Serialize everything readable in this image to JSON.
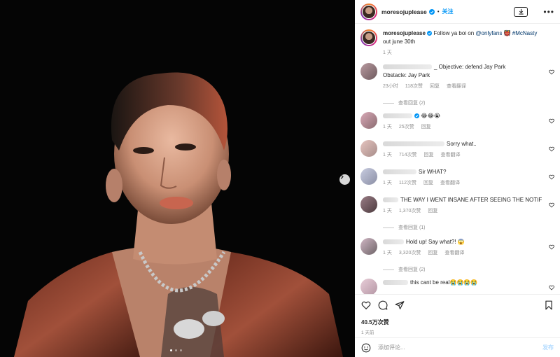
{
  "colors": {
    "accent": "#0095f6",
    "link": "#00376b",
    "muted": "#8e8e8e"
  },
  "post": {
    "username": "moresojuplease",
    "follow_label": "关注",
    "separator": "•",
    "more_label": "•••",
    "caption_prefix": "Follow ya boi on ",
    "caption_mention": "@onlyfans",
    "caption_emoji": "👹",
    "caption_hashtag": "#McNasty",
    "caption_line2": "out june 30th",
    "caption_time": "1 天",
    "carousel_total": 3,
    "carousel_active": 1
  },
  "comments": [
    {
      "text": "_ Objective: defend Jay Park",
      "line2": "Obstacle: Jay Park",
      "time": "23小时",
      "likes": "118次赞",
      "reply": "回复",
      "translate": "查看翻译",
      "replies": "查看回复 (2)"
    },
    {
      "text": "😂😂😭",
      "time": "1 天",
      "likes": "25次赞",
      "reply": "回复"
    },
    {
      "text": "Sorry what..",
      "time": "1 天",
      "likes": "714次赞",
      "reply": "回复",
      "translate": "查看翻译"
    },
    {
      "text": "Sir WHAT?",
      "time": "1 天",
      "likes": "112次赞",
      "reply": "回复",
      "translate": "查看翻译"
    },
    {
      "text": "THE WAY I WENT INSANE AFTER SEEING THE NOTIF",
      "time": "1 天",
      "likes": "1,370次赞",
      "reply": "回复",
      "replies": "查看回复 (1)"
    },
    {
      "text": "Hold up! Say what?! 😱",
      "time": "1 天",
      "likes": "3,320次赞",
      "reply": "回复",
      "translate": "查看翻译",
      "replies": "查看回复 (2)"
    },
    {
      "text": "this cant be real😭😭😭😭"
    }
  ],
  "footer": {
    "likes": "40.5万次赞",
    "time": "1 天前",
    "comment_placeholder": "添加评论...",
    "post_label": "发布"
  },
  "icons": [
    "verified-badge-icon",
    "download-icon",
    "heart-icon",
    "comment-icon",
    "share-icon",
    "bookmark-icon",
    "emoji-icon",
    "chevron-right-icon"
  ]
}
